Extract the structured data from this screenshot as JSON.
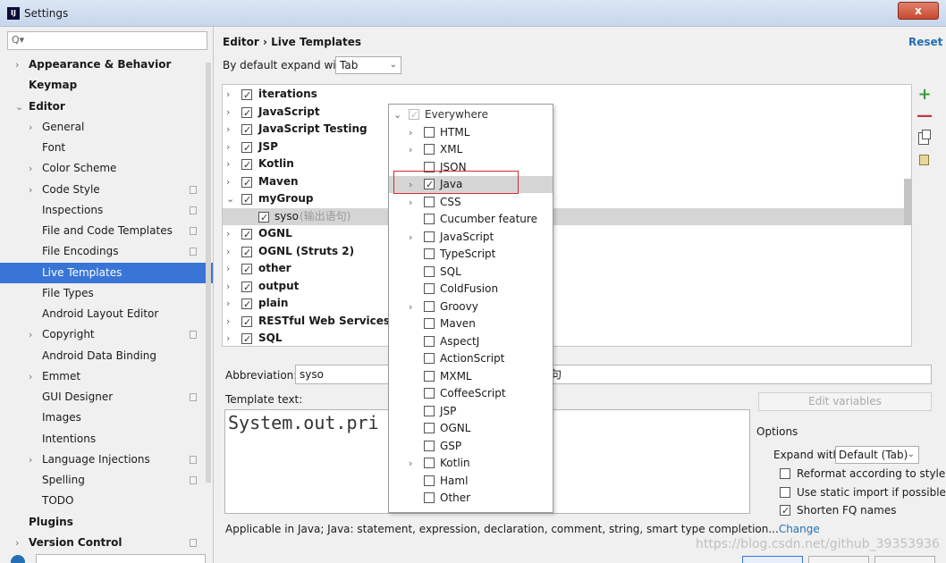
{
  "window": {
    "app_icon": "IJ",
    "title": "Settings",
    "close_label": "x"
  },
  "search": {
    "icon": "Q▾"
  },
  "sidebar": {
    "items": [
      {
        "label": "Appearance & Behavior",
        "chevron": "›",
        "bold": true
      },
      {
        "label": "Keymap",
        "chevron": "",
        "bold": true
      },
      {
        "label": "Editor",
        "chevron": "⌄",
        "bold": true
      },
      {
        "label": "General",
        "chevron": "›"
      },
      {
        "label": "Font",
        "chevron": ""
      },
      {
        "label": "Color Scheme",
        "chevron": "›"
      },
      {
        "label": "Code Style",
        "chevron": "›",
        "copy": true
      },
      {
        "label": "Inspections",
        "chevron": "",
        "copy": true
      },
      {
        "label": "File and Code Templates",
        "chevron": "",
        "copy": true
      },
      {
        "label": "File Encodings",
        "chevron": "",
        "copy": true
      },
      {
        "label": "Live Templates",
        "chevron": "",
        "active": true
      },
      {
        "label": "File Types",
        "chevron": ""
      },
      {
        "label": "Android Layout Editor",
        "chevron": ""
      },
      {
        "label": "Copyright",
        "chevron": "›",
        "copy": true
      },
      {
        "label": "Android Data Binding",
        "chevron": ""
      },
      {
        "label": "Emmet",
        "chevron": "›"
      },
      {
        "label": "GUI Designer",
        "chevron": "",
        "copy": true
      },
      {
        "label": "Images",
        "chevron": ""
      },
      {
        "label": "Intentions",
        "chevron": ""
      },
      {
        "label": "Language Injections",
        "chevron": "›",
        "copy": true
      },
      {
        "label": "Spelling",
        "chevron": "",
        "copy": true
      },
      {
        "label": "TODO",
        "chevron": ""
      },
      {
        "label": "Plugins",
        "chevron": "",
        "bold": true
      },
      {
        "label": "Version Control",
        "chevron": "›",
        "bold": true,
        "copy": true
      }
    ]
  },
  "header": {
    "breadcrumb": "Editor  ›  Live Templates",
    "reset": "Reset"
  },
  "expand": {
    "label": "By default expand with",
    "value": "Tab"
  },
  "tree": [
    {
      "label": "iterations",
      "toggle": "›",
      "checked": true
    },
    {
      "label": "JavaScript",
      "toggle": "›",
      "checked": true
    },
    {
      "label": "JavaScript Testing",
      "toggle": "›",
      "checked": true
    },
    {
      "label": "JSP",
      "toggle": "›",
      "checked": true
    },
    {
      "label": "Kotlin",
      "toggle": "›",
      "checked": true
    },
    {
      "label": "Maven",
      "toggle": "›",
      "checked": true
    },
    {
      "label": "myGroup",
      "toggle": "⌄",
      "checked": true
    },
    {
      "label": "syso",
      "desc": "(输出语句)",
      "toggle": "",
      "checked": true,
      "child": true,
      "selected": true
    },
    {
      "label": "OGNL",
      "toggle": "›",
      "checked": true
    },
    {
      "label": "OGNL (Struts 2)",
      "toggle": "›",
      "checked": true
    },
    {
      "label": "other",
      "toggle": "›",
      "checked": true
    },
    {
      "label": "output",
      "toggle": "›",
      "checked": true
    },
    {
      "label": "plain",
      "toggle": "›",
      "checked": true
    },
    {
      "label": "RESTful Web Services",
      "toggle": "›",
      "checked": true
    },
    {
      "label": "SQL",
      "toggle": "›",
      "checked": true
    }
  ],
  "toolbar": {
    "add": "+",
    "remove": "—"
  },
  "popup": [
    {
      "label": "Everywhere",
      "toggle": "⌄",
      "checked": true,
      "level": 0,
      "disabled": true
    },
    {
      "label": "HTML",
      "toggle": "›",
      "checked": false,
      "level": 1
    },
    {
      "label": "XML",
      "toggle": "›",
      "checked": false,
      "level": 1
    },
    {
      "label": "JSON",
      "toggle": "",
      "checked": false,
      "level": 1
    },
    {
      "label": "Java",
      "toggle": "›",
      "checked": true,
      "level": 1,
      "selected": true
    },
    {
      "label": "CSS",
      "toggle": "›",
      "checked": false,
      "level": 1
    },
    {
      "label": "Cucumber feature",
      "toggle": "",
      "checked": false,
      "level": 1
    },
    {
      "label": "JavaScript",
      "toggle": "›",
      "checked": false,
      "level": 1
    },
    {
      "label": "TypeScript",
      "toggle": "",
      "checked": false,
      "level": 1
    },
    {
      "label": "SQL",
      "toggle": "",
      "checked": false,
      "level": 1
    },
    {
      "label": "ColdFusion",
      "toggle": "",
      "checked": false,
      "level": 1
    },
    {
      "label": "Groovy",
      "toggle": "›",
      "checked": false,
      "level": 1
    },
    {
      "label": "Maven",
      "toggle": "",
      "checked": false,
      "level": 1
    },
    {
      "label": "AspectJ",
      "toggle": "",
      "checked": false,
      "level": 1
    },
    {
      "label": "ActionScript",
      "toggle": "",
      "checked": false,
      "level": 1
    },
    {
      "label": "MXML",
      "toggle": "",
      "checked": false,
      "level": 1
    },
    {
      "label": "CoffeeScript",
      "toggle": "",
      "checked": false,
      "level": 1
    },
    {
      "label": "JSP",
      "toggle": "",
      "checked": false,
      "level": 1
    },
    {
      "label": "OGNL",
      "toggle": "",
      "checked": false,
      "level": 1
    },
    {
      "label": "GSP",
      "toggle": "",
      "checked": false,
      "level": 1
    },
    {
      "label": "Kotlin",
      "toggle": "›",
      "checked": false,
      "level": 1
    },
    {
      "label": "Haml",
      "toggle": "",
      "checked": false,
      "level": 1
    },
    {
      "label": "Other",
      "toggle": "",
      "checked": false,
      "level": 1
    }
  ],
  "abbreviation": {
    "label": "Abbreviation:",
    "value": "syso",
    "desc_fragment": "句"
  },
  "template": {
    "label": "Template text:",
    "text": "System.out.pri"
  },
  "edit_variables": "Edit variables",
  "options": {
    "label": "Options",
    "expand_label": "Expand with",
    "expand_value": "Default (Tab)",
    "checks": [
      {
        "label": "Reformat according to style",
        "checked": false
      },
      {
        "label": "Use static import if possible",
        "checked": false
      },
      {
        "label": "Shorten FQ names",
        "checked": true
      }
    ]
  },
  "applicable": {
    "text": "Applicable in Java; Java: statement, expression, declaration, comment, string, smart type completion...",
    "link": "Change"
  },
  "watermark": "https://blog.csdn.net/github_39353936",
  "colors": {
    "accent": "#3875d7",
    "link": "#2470b3",
    "highlight_box": "#d03030"
  }
}
